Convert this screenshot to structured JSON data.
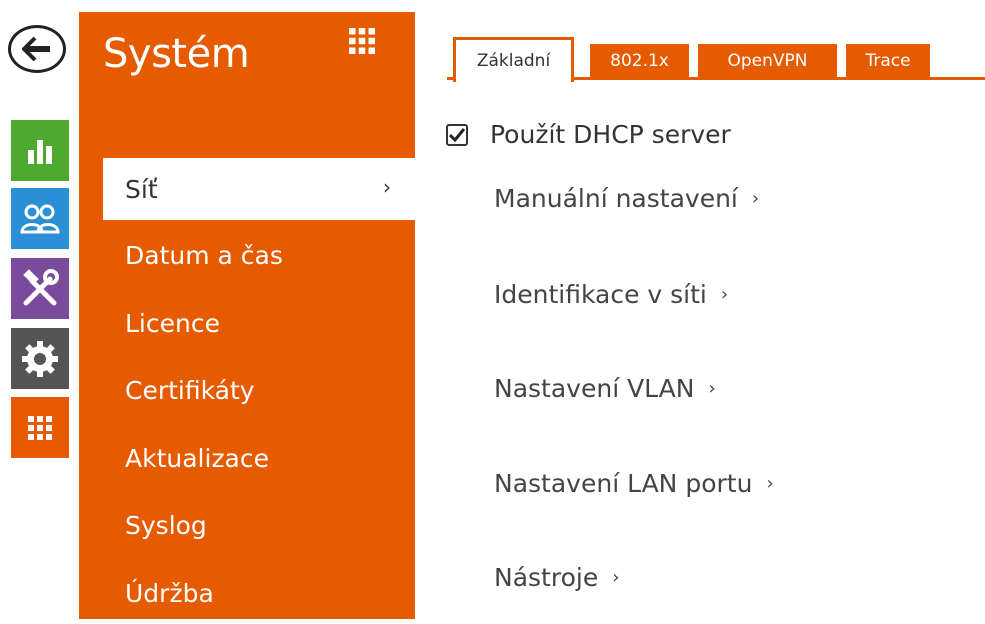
{
  "rail": {
    "icons": [
      "back-arrow-icon",
      "status-chart-icon",
      "users-icon",
      "services-tools-icon",
      "hardware-gear-icon",
      "system-grid-icon"
    ],
    "colors": {
      "status": "#4fa82f",
      "users": "#2b8fd6",
      "services": "#7a4b9c",
      "hardware": "#555555",
      "system": "#e85a00"
    }
  },
  "sidebar": {
    "title": "Systém",
    "accent": "#e65a00",
    "items": [
      {
        "label": "Síť",
        "active": true
      },
      {
        "label": "Datum a čas"
      },
      {
        "label": "Licence"
      },
      {
        "label": "Certifikáty"
      },
      {
        "label": "Aktualizace"
      },
      {
        "label": "Syslog"
      },
      {
        "label": "Údržba"
      }
    ]
  },
  "tabs": [
    {
      "label": "Základní",
      "active": true
    },
    {
      "label": "802.1x"
    },
    {
      "label": "OpenVPN"
    },
    {
      "label": "Trace"
    }
  ],
  "content": {
    "dhcp_label": "Použít DHCP server",
    "dhcp_checked": true,
    "links": [
      "Manuální nastavení",
      "Identifikace v síti",
      "Nastavení VLAN",
      "Nastavení LAN portu",
      "Nástroje"
    ]
  }
}
